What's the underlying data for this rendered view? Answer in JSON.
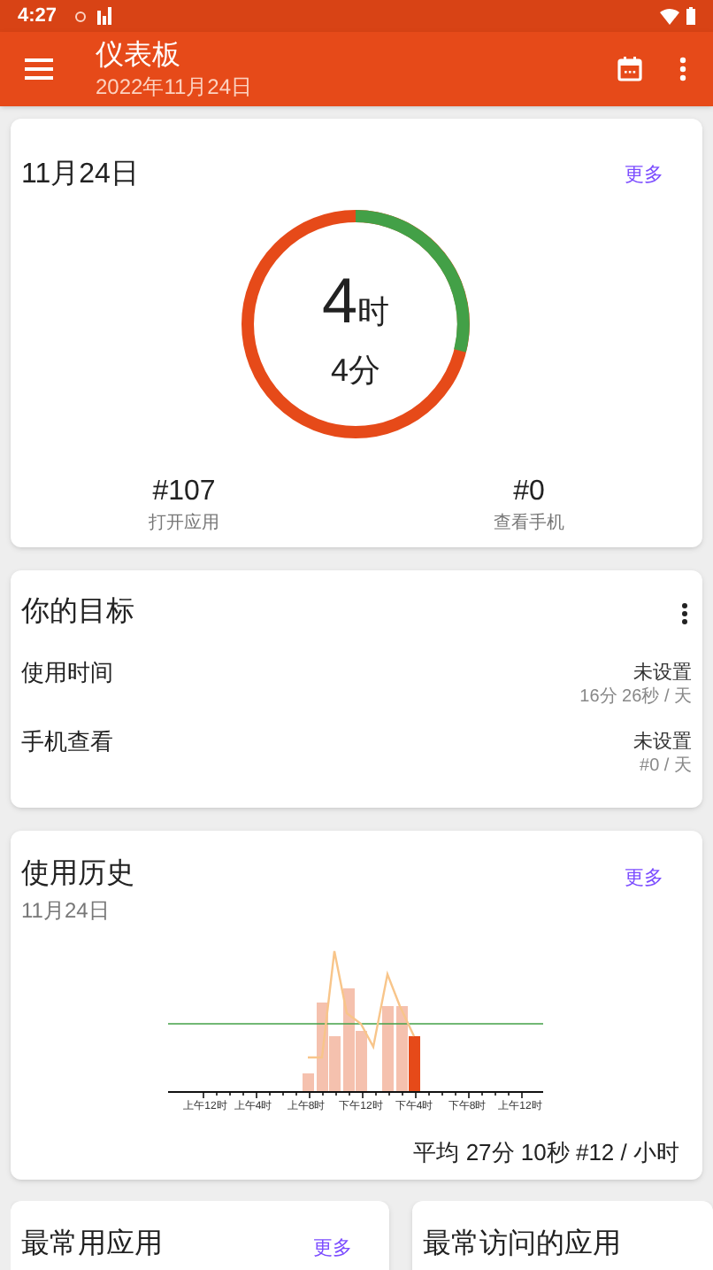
{
  "status_bar": {
    "time": "4:27"
  },
  "app_bar": {
    "title": "仪表板",
    "subtitle": "2022年11月24日"
  },
  "today_card": {
    "title": "11月24日",
    "more": "更多",
    "hours": "4",
    "hours_unit": "时",
    "minutes": "4分",
    "stats": [
      {
        "value": "#107",
        "label": "打开应用"
      },
      {
        "value": "#0",
        "label": "查看手机"
      }
    ]
  },
  "goals_card": {
    "title": "你的目标",
    "goals": [
      {
        "label": "使用时间",
        "status": "未设置",
        "detail": "16分 26秒 / 天"
      },
      {
        "label": "手机查看",
        "status": "未设置",
        "detail": "#0 / 天"
      }
    ]
  },
  "history_card": {
    "title": "使用历史",
    "date": "11月24日",
    "more": "更多",
    "x_labels": [
      "上午12时",
      "上午4时",
      "上午8时",
      "下午12时",
      "下午4时",
      "下午8时",
      "上午12时"
    ],
    "summary": "平均 27分 10秒 #12 / 小时"
  },
  "bottom_cards": [
    {
      "title": "最常用应用",
      "more": "更多"
    },
    {
      "title": "最常访问的应用"
    }
  ]
}
